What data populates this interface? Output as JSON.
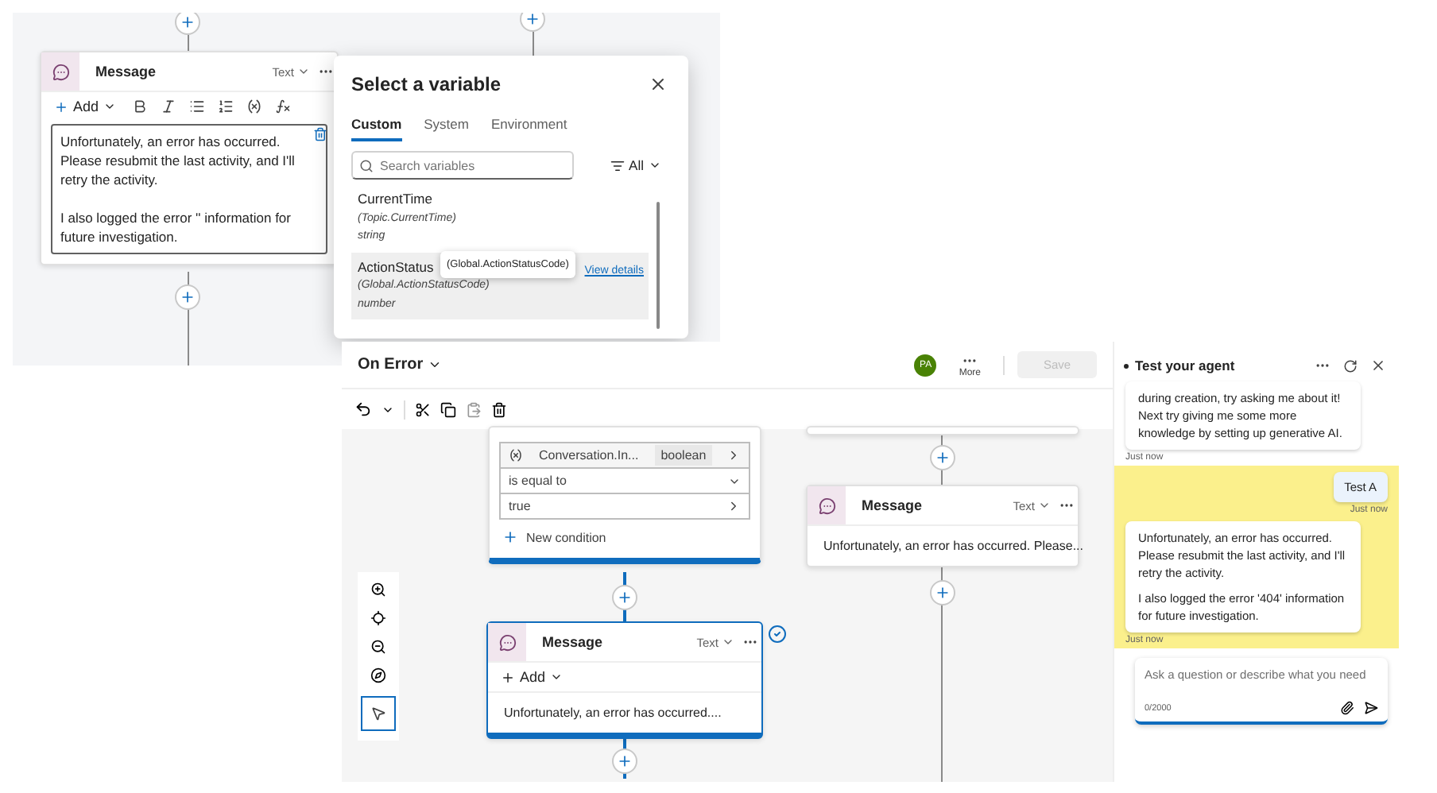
{
  "top_screenshot": {
    "message_node": {
      "title": "Message",
      "format": "Text",
      "add": "Add",
      "paragraphs": [
        "Unfortunately, an error has occurred. Please resubmit the last activity, and I'll retry the activity.",
        "I also logged the error '' information for future investigation."
      ]
    },
    "variable_dialog": {
      "title": "Select a variable",
      "tabs": [
        {
          "label": "Custom",
          "selected": true
        },
        {
          "label": "System",
          "selected": false
        },
        {
          "label": "Environment",
          "selected": false
        }
      ],
      "search": {
        "placeholder": "Search variables"
      },
      "filter": "All",
      "variables": [
        {
          "name": "CurrentTime",
          "path": "(Topic.CurrentTime)",
          "type": "string",
          "selected": false
        },
        {
          "name": "ActionStatus",
          "path": "(Global.ActionStatusCode)",
          "type": "number",
          "selected": true,
          "link": "View details",
          "tooltip": "(Global.ActionStatusCode)"
        }
      ]
    }
  },
  "bottom_screenshot": {
    "topic_title": "On Error",
    "avatar": "PA",
    "more": "More",
    "save": {
      "label": "Save",
      "disabled": true
    },
    "condition_node": {
      "variable": "Conversation.In...",
      "variable_type": "boolean",
      "operator": "is equal to",
      "value": "true",
      "add_condition": "New condition"
    },
    "message_nodes": [
      {
        "title": "Message",
        "format": "Text",
        "add": "Add",
        "preview": "Unfortunately, an error has occurred....",
        "selected": true
      },
      {
        "title": "Message",
        "format": "Text",
        "preview": "Unfortunately, an error has occurred. Please...",
        "selected": false
      }
    ],
    "test_panel": {
      "title": "Test your agent",
      "messages": [
        {
          "kind": "bot",
          "paragraphs": [
            "during creation, try asking me about it! Next try giving me some more knowledge by setting up generative AI."
          ],
          "time": "Just now",
          "highlighted": false
        },
        {
          "kind": "user",
          "paragraphs": [
            "Test A"
          ],
          "time": "Just now",
          "highlighted": true
        },
        {
          "kind": "bot",
          "paragraphs": [
            "Unfortunately, an error has occurred. Please resubmit the last activity, and I'll retry the activity.",
            "I also logged the error '404' information for future investigation."
          ],
          "time": "Just now",
          "highlighted": true
        }
      ],
      "input": {
        "placeholder": "Ask a question or describe what you need",
        "counter": "0/2000"
      }
    }
  }
}
